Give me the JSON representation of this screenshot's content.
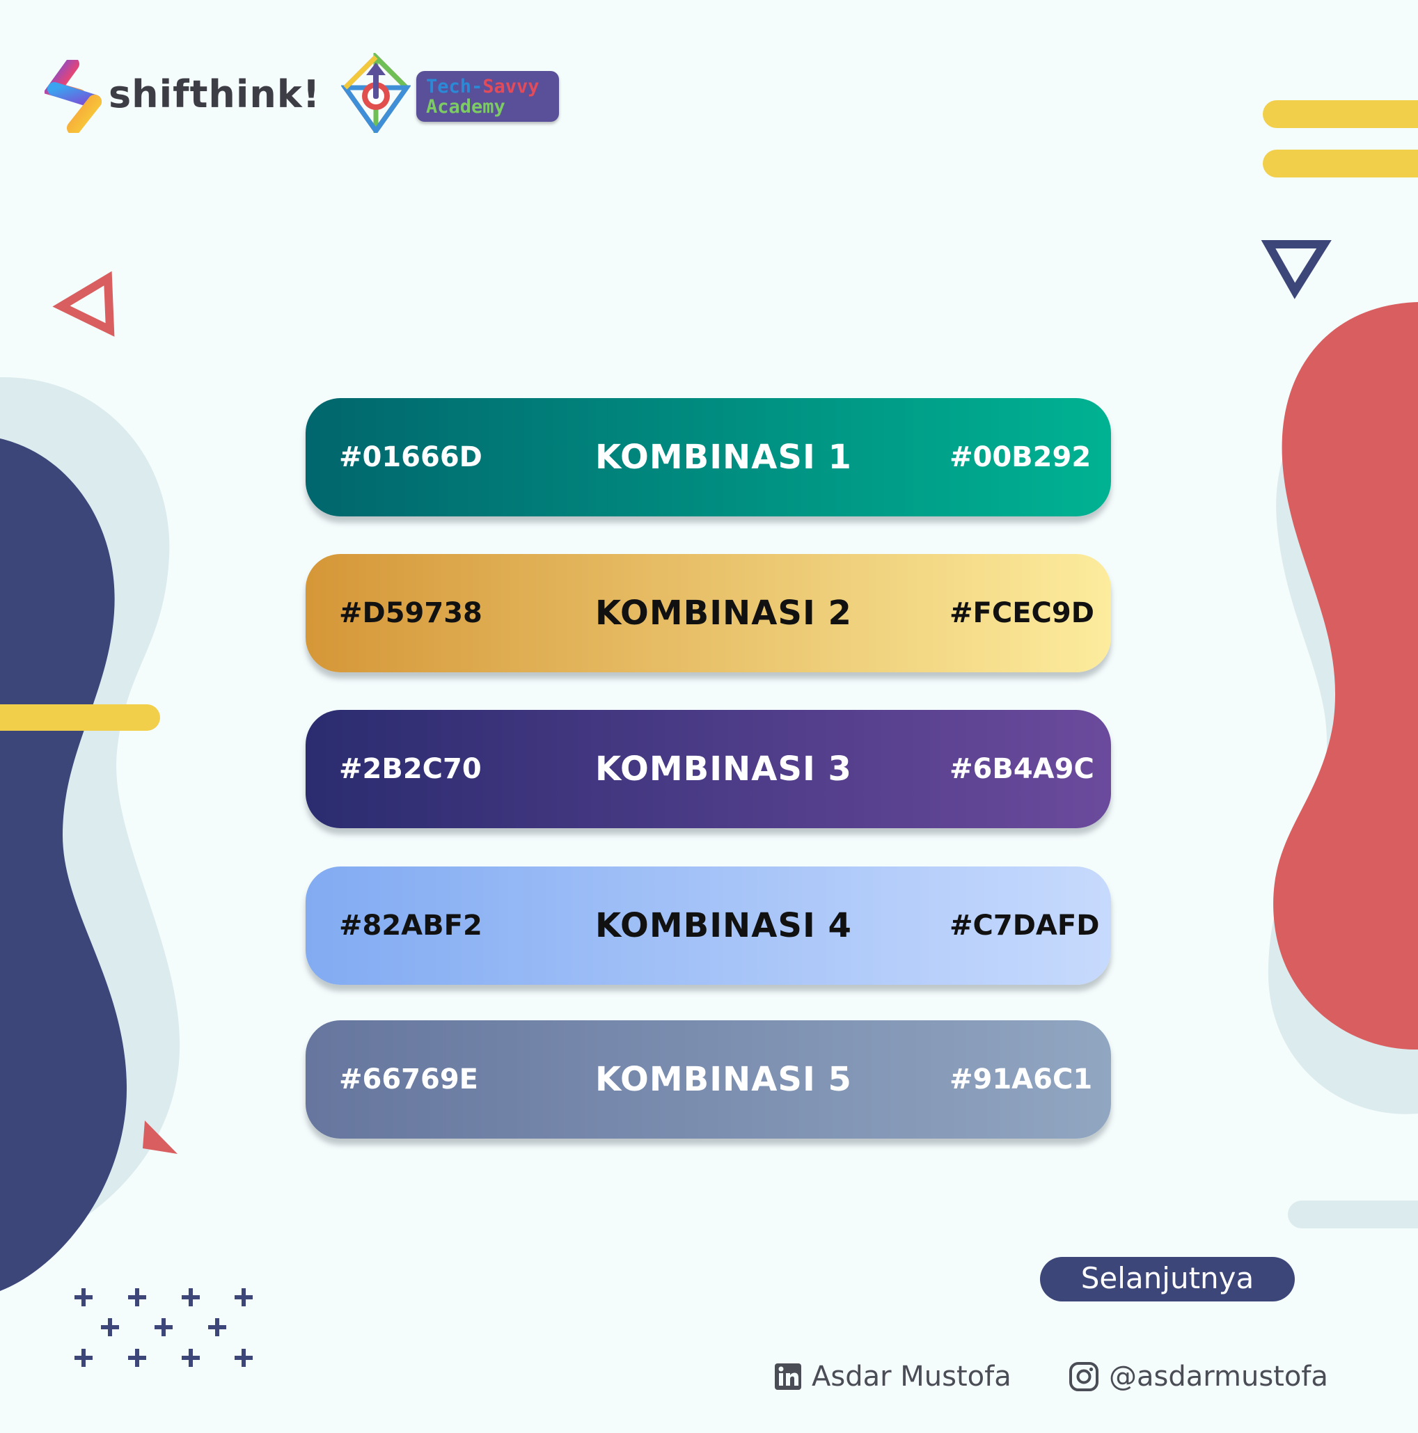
{
  "brand": {
    "shifthink_label": "shifthink!",
    "academy_line1_a": "Tech-",
    "academy_line1_b": "Savvy",
    "academy_line2": "Academy"
  },
  "combinations": [
    {
      "title": "KOMBINASI 1",
      "hex_left": "#01666D",
      "hex_right": "#00B292"
    },
    {
      "title": "KOMBINASI 2",
      "hex_left": "#D59738",
      "hex_right": "#FCEC9D"
    },
    {
      "title": "KOMBINASI 3",
      "hex_left": "#2B2C70",
      "hex_right": "#6B4A9C"
    },
    {
      "title": "KOMBINASI 4",
      "hex_left": "#82ABF2",
      "hex_right": "#C7DAFD"
    },
    {
      "title": "KOMBINASI 5",
      "hex_left": "#66769E",
      "hex_right": "#91A6C1"
    }
  ],
  "navigation": {
    "next_label": "Selanjutnya"
  },
  "footer": {
    "linkedin_name": "Asdar Mustofa",
    "instagram_handle": "@asdarmustofa"
  },
  "colors": {
    "background": "#f5fcfc",
    "navy": "#3c4679",
    "red": "#d95e5f",
    "yellow": "#f2cf4a",
    "pale_blob": "#dcebed"
  }
}
